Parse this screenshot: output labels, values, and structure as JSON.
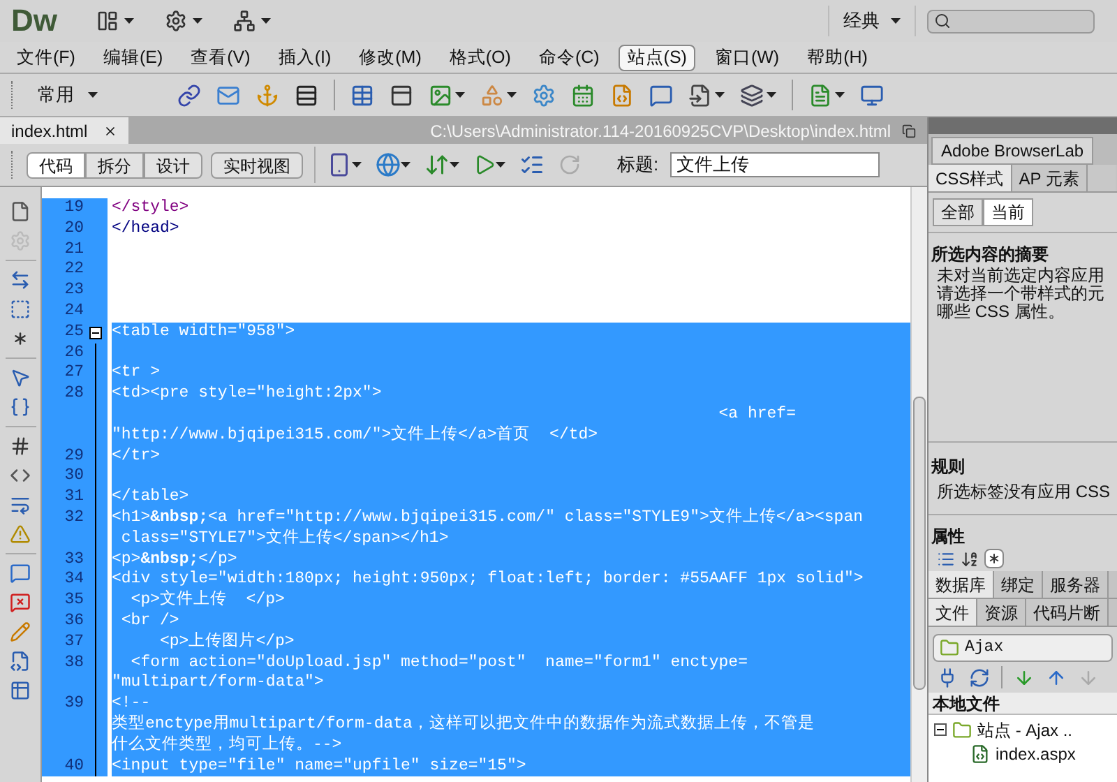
{
  "app": {
    "logo": "Dw",
    "workspace": "经典"
  },
  "menu": [
    {
      "label": "文件(F)",
      "selected": false
    },
    {
      "label": "编辑(E)",
      "selected": false
    },
    {
      "label": "查看(V)",
      "selected": false
    },
    {
      "label": "插入(I)",
      "selected": false
    },
    {
      "label": "修改(M)",
      "selected": false
    },
    {
      "label": "格式(O)",
      "selected": false
    },
    {
      "label": "命令(C)",
      "selected": false
    },
    {
      "label": "站点(S)",
      "selected": true
    },
    {
      "label": "窗口(W)",
      "selected": false
    },
    {
      "label": "帮助(H)",
      "selected": false
    }
  ],
  "insert_bar": {
    "category": "常用"
  },
  "document_tab": {
    "filename": "index.html",
    "path": "C:\\Users\\Administrator.114-20160925CVP\\Desktop\\index.html"
  },
  "view_buttons": [
    {
      "label": "代码",
      "selected": true
    },
    {
      "label": "拆分",
      "selected": false
    },
    {
      "label": "设计",
      "selected": false
    },
    {
      "label": "实时视图",
      "selected": false
    }
  ],
  "title_field": {
    "label": "标题:",
    "value": "文件上传"
  },
  "code": [
    {
      "number": "19",
      "selected": false,
      "color": "#800080",
      "rows": [
        "</style>"
      ]
    },
    {
      "number": "20",
      "selected": false,
      "color": "#000080",
      "rows": [
        "</head>"
      ]
    },
    {
      "number": "21",
      "selected": false
    },
    {
      "number": "22",
      "selected": false
    },
    {
      "number": "23",
      "selected": false
    },
    {
      "number": "24",
      "selected": false
    },
    {
      "number": "25",
      "selected": true,
      "expanded": true,
      "rows": [
        "<table width=\"958\">"
      ]
    },
    {
      "number": "26",
      "selected": true
    },
    {
      "number": "27",
      "selected": true,
      "rows": [
        "<tr >"
      ]
    },
    {
      "number": "28",
      "selected": true,
      "rows": [
        "<td><pre style=\"height:2px\">",
        "                                                               <a href=",
        "\"http://www.bjqipei315.com/\">文件上传</a>首页  </td>"
      ]
    },
    {
      "number": "29",
      "selected": true,
      "rows": [
        "</tr>"
      ]
    },
    {
      "number": "30",
      "selected": true
    },
    {
      "number": "31",
      "selected": true,
      "rows": [
        "</table>"
      ]
    },
    {
      "number": "32",
      "selected": true,
      "rows": [
        "<h1>**&nbsp;**<a href=\"http://www.bjqipei315.com/\" class=\"STYLE9\">文件上传</a><span",
        " class=\"STYLE7\">文件上传</span></h1>"
      ]
    },
    {
      "number": "33",
      "selected": true,
      "rows": [
        "<p>**&nbsp;**</p>"
      ]
    },
    {
      "number": "34",
      "selected": true,
      "rows": [
        "<div style=\"width:180px; height:950px; float:left; border: #55AAFF 1px solid\">"
      ]
    },
    {
      "number": "35",
      "selected": true,
      "rows": [
        "  <p>文件上传  </p>"
      ]
    },
    {
      "number": "36",
      "selected": true,
      "rows": [
        " <br />"
      ]
    },
    {
      "number": "37",
      "selected": true,
      "rows": [
        "     <p>上传图片</p>"
      ]
    },
    {
      "number": "38",
      "selected": true,
      "rows": [
        "  <form action=\"doUpload.jsp\" method=\"post\"  name=\"form1\" enctype=",
        "\"multipart/form-data\">"
      ]
    },
    {
      "number": "39",
      "selected": true,
      "rows": [
        "<!--",
        "类型enctype用multipart/form-data，这样可以把文件中的数据作为流式数据上传，不管是",
        "什么文件类型，均可上传。-->"
      ]
    },
    {
      "number": "40",
      "selected": true,
      "rows": [
        "<input type=\"file\" name=\"upfile\" size=\"15\">"
      ]
    }
  ],
  "panel": {
    "top_tabs": [
      {
        "label": "Adobe BrowserLab",
        "selected": true
      }
    ],
    "css_tabs": [
      {
        "label": "CSS样式",
        "selected": true
      },
      {
        "label": "AP 元素",
        "selected": false
      }
    ],
    "mode_buttons": [
      {
        "label": "全部",
        "selected": false
      },
      {
        "label": "当前",
        "selected": true
      }
    ],
    "summary": {
      "heading": "所选内容的摘要",
      "lines": [
        "未对当前选定内容应用",
        "请选择一个带样式的元",
        "哪些 CSS 属性。"
      ]
    },
    "rules": {
      "heading": "规则",
      "text": "所选标签没有应用 CSS"
    },
    "properties": {
      "heading": "属性"
    },
    "db_tabs": [
      {
        "label": "数据库",
        "selected": true
      },
      {
        "label": "绑定",
        "selected": false
      },
      {
        "label": "服务器",
        "selected": false
      }
    ],
    "file_tabs": [
      {
        "label": "文件",
        "selected": true
      },
      {
        "label": "资源",
        "selected": false
      },
      {
        "label": "代码片断",
        "selected": false
      }
    ],
    "site_select": "Ajax",
    "files_header": "本地文件",
    "tree": [
      {
        "label": "站点 - Ajax ..",
        "expanded": true,
        "children": [
          {
            "label": "index.aspx"
          }
        ]
      }
    ]
  }
}
